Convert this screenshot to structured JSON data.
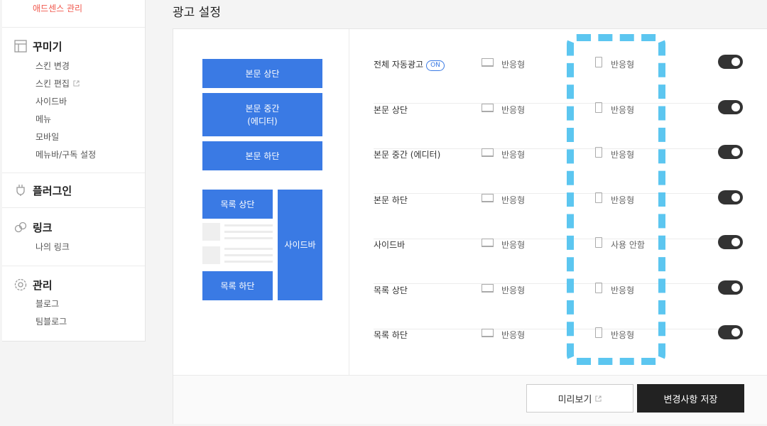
{
  "sidebar": {
    "top_link": "애드센스 관리",
    "sections": [
      {
        "title": "꾸미기",
        "icon": "layout-icon",
        "items": [
          "스킨 변경",
          "스킨 편집",
          "사이드바",
          "메뉴",
          "모바일",
          "메뉴바/구독 설정"
        ]
      },
      {
        "title": "플러그인",
        "icon": "plug-icon",
        "items": []
      },
      {
        "title": "링크",
        "icon": "link-icon",
        "items": [
          "나의 링크"
        ]
      },
      {
        "title": "관리",
        "icon": "gear-icon",
        "items": [
          "블로그",
          "팀블로그"
        ]
      }
    ]
  },
  "page": {
    "title": "광고 설정"
  },
  "diagram": {
    "top": "본문 상단",
    "middle_line1": "본문 중간",
    "middle_line2": "(에디터)",
    "bottom": "본문 하단",
    "list_top": "목록 상단",
    "list_bottom": "목록 하단",
    "sidebar": "사이드바",
    "block_color": "#3a7ae4"
  },
  "settings": {
    "on_badge": "ON",
    "rows": [
      {
        "label": "전체 자동광고",
        "pc": "반응형",
        "mobile": "반응형",
        "enabled": true
      },
      {
        "label": "본문 상단",
        "pc": "반응형",
        "mobile": "반응형",
        "enabled": true
      },
      {
        "label": "본문 중간 (에디터)",
        "pc": "반응형",
        "mobile": "반응형",
        "enabled": true
      },
      {
        "label": "본문 하단",
        "pc": "반응형",
        "mobile": "반응형",
        "enabled": true
      },
      {
        "label": "사이드바",
        "pc": "반응형",
        "mobile": "사용 안함",
        "enabled": true
      },
      {
        "label": "목록 상단",
        "pc": "반응형",
        "mobile": "반응형",
        "enabled": true
      },
      {
        "label": "목록 하단",
        "pc": "반응형",
        "mobile": "반응형",
        "enabled": true
      }
    ]
  },
  "footer": {
    "preview_label": "미리보기",
    "save_label": "변경사항 저장"
  },
  "colors": {
    "accent": "#3a7ae4",
    "highlight": "#5cc6f0",
    "top_link": "#f0584d",
    "toggle_on": "#333333"
  }
}
